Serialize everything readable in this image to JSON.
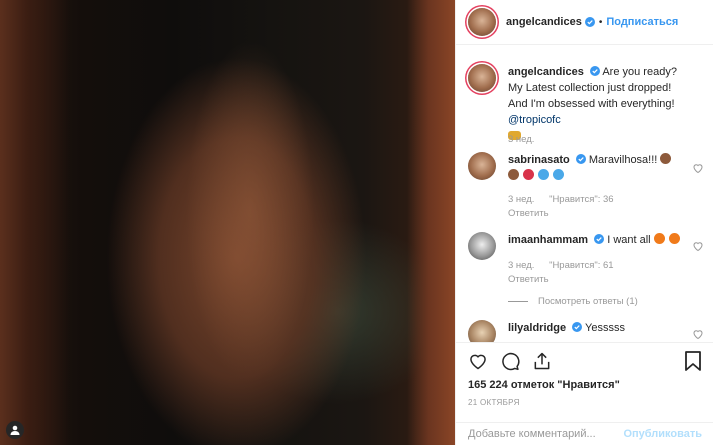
{
  "post": {
    "author": "angelcandices",
    "follow_label": "Подписаться",
    "separator": "•"
  },
  "comments": [
    {
      "username": "angelcandices",
      "text_before": "Are you ready? My Latest collection just dropped! And I'm obsessed with everything!",
      "mention": "@tropicofc",
      "time": "3 нед."
    },
    {
      "username": "sabrinasato",
      "text": "Maravilhosa!!!",
      "time": "3 нед.",
      "likes": "\"Нравится\": 36",
      "reply": "Ответить"
    },
    {
      "username": "imaanhammam",
      "text": "I want all",
      "time": "3 нед.",
      "likes": "\"Нравится\": 61",
      "reply": "Ответить",
      "view_replies": "Посмотреть ответы (1)"
    },
    {
      "username": "lilyaldridge",
      "text": "Yesssss"
    }
  ],
  "actions": {
    "likes_count": "165 224 отметок \"Нравится\"",
    "date": "21 ОКТЯБРЯ"
  },
  "composer": {
    "placeholder": "Добавьте комментарий...",
    "publish_label": "Опубликовать"
  },
  "colors": {
    "link": "#3897f0",
    "muted": "#999999",
    "publish_disabled": "#b2dffc",
    "story_ring": "#e4405f"
  },
  "icons": [
    "verified-badge-icon",
    "heart-icon",
    "comment-icon",
    "share-icon",
    "bookmark-icon",
    "user-tag-icon"
  ]
}
